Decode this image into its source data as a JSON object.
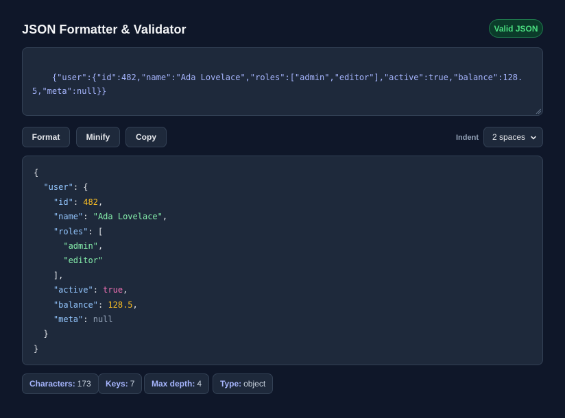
{
  "header": {
    "title": "JSON Formatter & Validator",
    "status_badge": "Valid JSON"
  },
  "input": {
    "value": "{\"user\":{\"id\":482,\"name\":\"Ada Lovelace\",\"roles\":[\"admin\",\"editor\"],\"active\":true,\"balance\":128.5,\"meta\":null}}"
  },
  "toolbar": {
    "format_label": "Format",
    "minify_label": "Minify",
    "copy_label": "Copy",
    "indent_label": "Indent",
    "indent_value": "2 spaces"
  },
  "output": {
    "lines": [
      [
        {
          "t": "p",
          "v": "{"
        }
      ],
      [
        {
          "t": "p",
          "v": "  "
        },
        {
          "t": "k",
          "v": "\"user\""
        },
        {
          "t": "p",
          "v": ": {"
        }
      ],
      [
        {
          "t": "p",
          "v": "    "
        },
        {
          "t": "k",
          "v": "\"id\""
        },
        {
          "t": "p",
          "v": ": "
        },
        {
          "t": "n",
          "v": "482"
        },
        {
          "t": "p",
          "v": ","
        }
      ],
      [
        {
          "t": "p",
          "v": "    "
        },
        {
          "t": "k",
          "v": "\"name\""
        },
        {
          "t": "p",
          "v": ": "
        },
        {
          "t": "s",
          "v": "\"Ada Lovelace\""
        },
        {
          "t": "p",
          "v": ","
        }
      ],
      [
        {
          "t": "p",
          "v": "    "
        },
        {
          "t": "k",
          "v": "\"roles\""
        },
        {
          "t": "p",
          "v": ": ["
        }
      ],
      [
        {
          "t": "p",
          "v": "      "
        },
        {
          "t": "s",
          "v": "\"admin\""
        },
        {
          "t": "p",
          "v": ","
        }
      ],
      [
        {
          "t": "p",
          "v": "      "
        },
        {
          "t": "s",
          "v": "\"editor\""
        }
      ],
      [
        {
          "t": "p",
          "v": "    ],"
        }
      ],
      [
        {
          "t": "p",
          "v": "    "
        },
        {
          "t": "k",
          "v": "\"active\""
        },
        {
          "t": "p",
          "v": ": "
        },
        {
          "t": "b",
          "v": "true"
        },
        {
          "t": "p",
          "v": ","
        }
      ],
      [
        {
          "t": "p",
          "v": "    "
        },
        {
          "t": "k",
          "v": "\"balance\""
        },
        {
          "t": "p",
          "v": ": "
        },
        {
          "t": "n",
          "v": "128.5"
        },
        {
          "t": "p",
          "v": ","
        }
      ],
      [
        {
          "t": "p",
          "v": "    "
        },
        {
          "t": "k",
          "v": "\"meta\""
        },
        {
          "t": "p",
          "v": ": "
        },
        {
          "t": "z",
          "v": "null"
        }
      ],
      [
        {
          "t": "p",
          "v": "  }"
        }
      ],
      [
        {
          "t": "p",
          "v": "}"
        }
      ]
    ]
  },
  "stats": {
    "characters_label": "Characters:",
    "characters_value": "173",
    "keys_label": "Keys:",
    "keys_value": "7",
    "depth_label": "Max depth:",
    "depth_value": "4",
    "type_label": "Type:",
    "type_value": "object"
  },
  "colors": {
    "background": "#0f1729",
    "panel": "#1e293b",
    "key": "#93c5fd",
    "string": "#86efac",
    "number": "#fbbf24",
    "boolean": "#f472b6",
    "null": "#94a3b8",
    "valid_badge": "#4ade80"
  }
}
